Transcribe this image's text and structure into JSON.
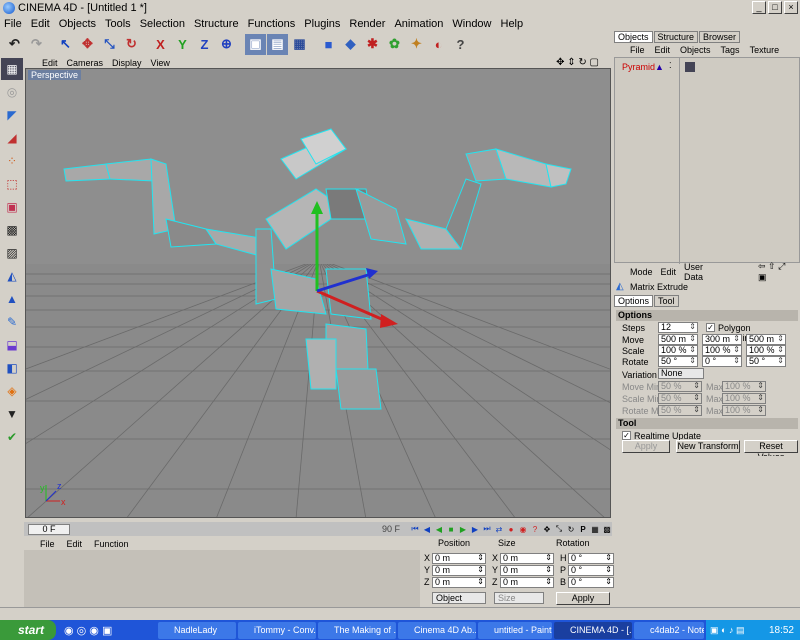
{
  "window": {
    "title": "CINEMA 4D - [Untitled 1 *]"
  },
  "menubar": [
    "File",
    "Edit",
    "Objects",
    "Tools",
    "Selection",
    "Structure",
    "Functions",
    "Plugins",
    "Render",
    "Animation",
    "Window",
    "Help"
  ],
  "toolbar": {
    "axis_x": "X",
    "axis_y": "Y",
    "axis_z": "Z"
  },
  "viewport": {
    "menu": [
      "Edit",
      "Cameras",
      "Display",
      "View"
    ],
    "label": "Perspective",
    "axis_x": "x",
    "axis_y": "y",
    "axis_z": "z"
  },
  "timeline": {
    "current_frame": "0 F",
    "end_frame": "90 F"
  },
  "material_manager": {
    "menu": [
      "File",
      "Edit",
      "Function"
    ]
  },
  "coordinates": {
    "headers": [
      "Position",
      "Size",
      "Rotation"
    ],
    "rows": [
      {
        "axis": "X",
        "pos": "0 m",
        "size_axis": "X",
        "size": "0 m",
        "rot_axis": "H",
        "rot": "0 °"
      },
      {
        "axis": "Y",
        "pos": "0 m",
        "size_axis": "Y",
        "size": "0 m",
        "rot_axis": "P",
        "rot": "0 °"
      },
      {
        "axis": "Z",
        "pos": "0 m",
        "size_axis": "Z",
        "size": "0 m",
        "rot_axis": "B",
        "rot": "0 °"
      }
    ],
    "mode": "Object",
    "size_mode": "Size",
    "apply": "Apply"
  },
  "object_manager": {
    "tabs": [
      "Objects",
      "Structure",
      "Browser"
    ],
    "menu": [
      "File",
      "Edit",
      "Objects",
      "Tags",
      "Texture"
    ],
    "object": "Pyramid"
  },
  "attributes": {
    "menu": [
      "Mode",
      "Edit",
      "User Data"
    ],
    "name": "Matrix Extrude",
    "tabs": [
      "Options",
      "Tool"
    ],
    "options_header": "Options",
    "steps_label": "Steps",
    "steps": "12",
    "polygon_coords": "Polygon Coordinates",
    "move_label": "Move",
    "move": [
      "500 m",
      "300 m",
      "500 m"
    ],
    "scale_label": "Scale",
    "scale": [
      "100 %",
      "100 %",
      "100 %"
    ],
    "rotate_label": "Rotate",
    "rotate": [
      "50 °",
      "0 °",
      "50 °"
    ],
    "variation_label": "Variation",
    "variation": "None",
    "move_min_label": "Move Min.",
    "move_min": "50 %",
    "move_max_label": "Max.",
    "move_max": "100 %",
    "scale_min_label": "Scale Min.",
    "scale_min": "50 %",
    "scale_max_label": "Max.",
    "scale_max": "100 %",
    "rotate_min_label": "Rotate Min.",
    "rotate_min": "50 %",
    "rotate_max_label": "Max.",
    "rotate_max": "100 %",
    "tool_header": "Tool",
    "realtime": "Realtime Update",
    "apply": "Apply",
    "new_transform": "New Transform",
    "reset": "Reset Values"
  },
  "taskbar": {
    "start": "start",
    "tasks": [
      "NadleLady",
      "iTommy - Conv...",
      "The Making of ...",
      "Cinema 4D Ab...",
      "untitled - Paint",
      "CINEMA 4D - [...",
      "c4dab2 - Note..."
    ],
    "clock": "18:52"
  }
}
